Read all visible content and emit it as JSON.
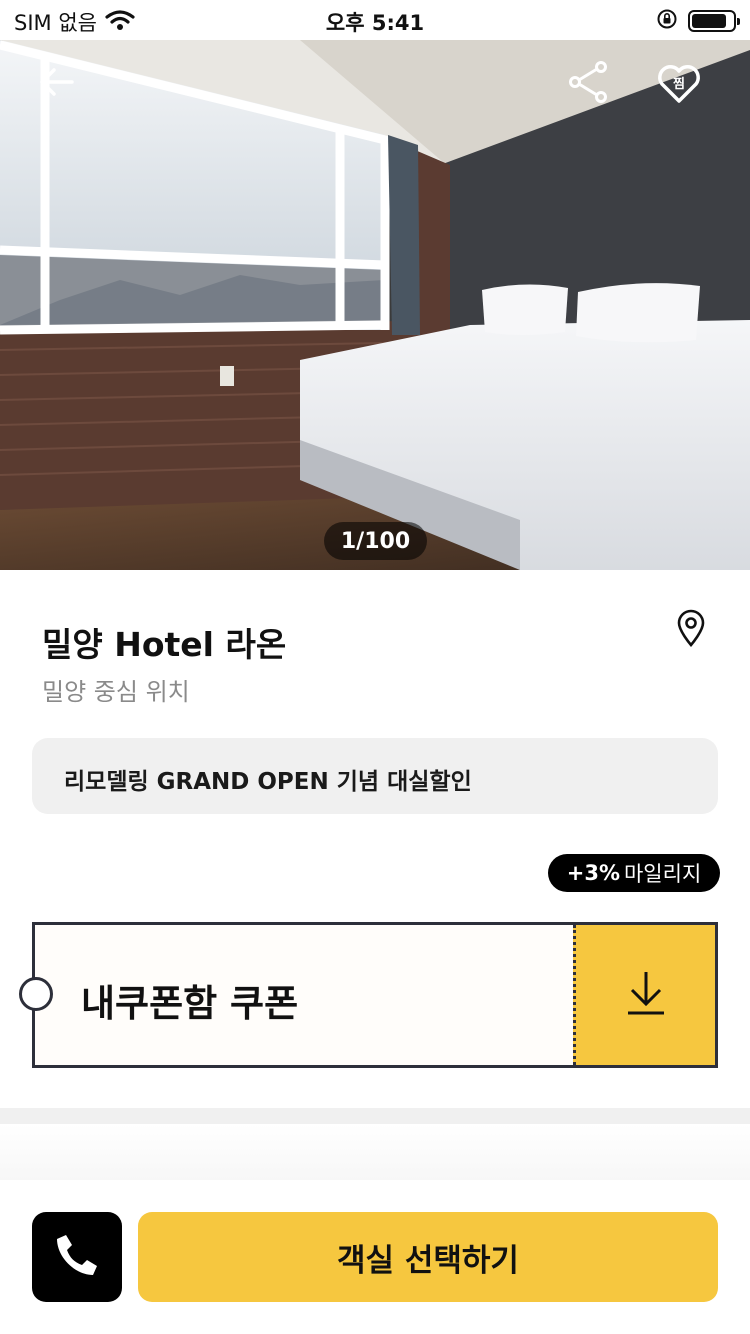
{
  "status_bar": {
    "carrier": "SIM 없음",
    "time": "오후 5:41"
  },
  "hero": {
    "counter": "1/100",
    "back_icon": "arrow-left-icon",
    "share_icon": "share-icon",
    "wishlist_icon": "heart-icon",
    "wishlist_label": "찜"
  },
  "hotel": {
    "name": "밀양 Hotel 라온",
    "subtitle": "밀양 중심 위치",
    "map_icon": "map-pin-icon"
  },
  "promo": {
    "text": "리모델링 GRAND OPEN 기념 대실할인"
  },
  "mileage": {
    "percent": "+3%",
    "label": "마일리지"
  },
  "coupon": {
    "label": "내쿠폰함 쿠폰",
    "icon": "download-icon"
  },
  "bottom_bar": {
    "call_icon": "phone-icon",
    "cta_label": "객실 선택하기"
  },
  "colors": {
    "accent": "#f6c73f",
    "dark": "#2d2f3a",
    "muted": "#8a8a8a",
    "promo_bg": "#f0f0f0"
  }
}
